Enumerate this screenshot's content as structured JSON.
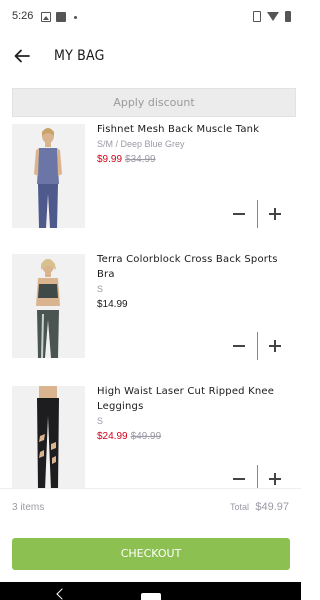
{
  "status_bar": {
    "time": "5:26"
  },
  "header": {
    "title": "MY BAG"
  },
  "discount": {
    "label": "Apply discount"
  },
  "items": [
    {
      "name": "Fishnet Mesh Back Muscle Tank",
      "variant": "S/M / Deep Blue Grey",
      "price": "$9.99",
      "original_price": "$34.99"
    },
    {
      "name": "Terra Colorblock Cross Back Sports Bra",
      "variant": "S",
      "price": "$14.99",
      "original_price": ""
    },
    {
      "name": "High Waist Laser Cut Ripped Knee Leggings",
      "variant": "S",
      "price": "$24.99",
      "original_price": "$49.99"
    }
  ],
  "summary": {
    "count": "3 items",
    "total_label": "Total",
    "total": "$49.97"
  },
  "checkout": {
    "label": "CHECKOUT"
  },
  "colors": {
    "accent": "#8cc152",
    "sale": "#d0021b",
    "muted": "#9a9aa6"
  }
}
